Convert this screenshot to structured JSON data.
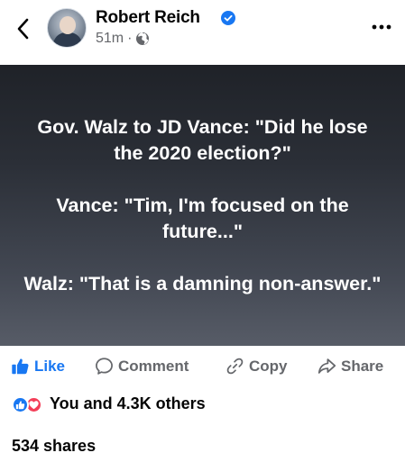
{
  "post": {
    "author": "Robert Reich",
    "time": "51m",
    "separator": "·",
    "paragraphs": [
      "Gov. Walz to JD Vance: \"Did he lose the 2020 election?\"",
      "Vance: \"Tim, I'm focused on the future...\"",
      "Walz: \"That is a damning non-answer.\""
    ]
  },
  "actions": {
    "like": "Like",
    "comment": "Comment",
    "copy": "Copy",
    "share": "Share"
  },
  "stats": {
    "reactions": "You and 4.3K others",
    "shares": "534 shares"
  },
  "icons": {
    "back": "chevron-left-icon",
    "verified": "verified-badge-icon",
    "audience": "globe-icon",
    "more": "more-horizontal-icon",
    "like": "thumbs-up-icon",
    "comment": "comment-bubble-icon",
    "copy": "link-icon",
    "share": "share-arrow-icon",
    "reaction_like": "like-reaction-icon",
    "reaction_love": "love-reaction-icon"
  },
  "colors": {
    "accent": "#1877f2",
    "muted": "#65676b",
    "love": "#f33e58"
  }
}
